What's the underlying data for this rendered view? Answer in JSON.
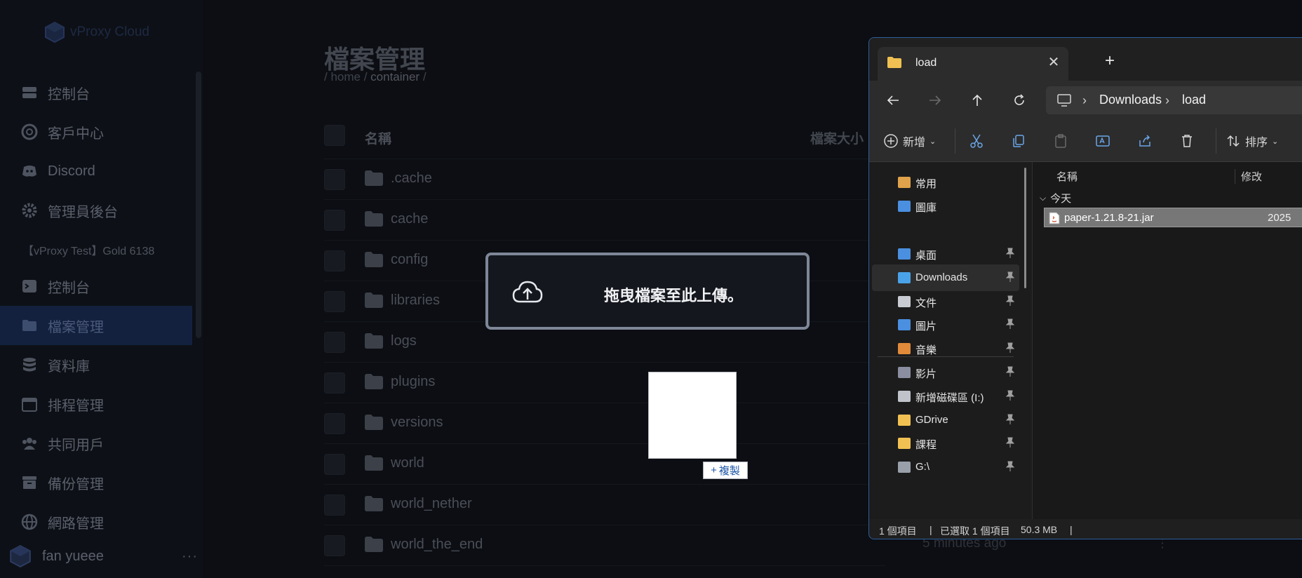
{
  "sidebar": {
    "logo": "vProxy Cloud",
    "items_top": [
      {
        "label": "控制台"
      },
      {
        "label": "客戶中心"
      },
      {
        "label": "Discord"
      },
      {
        "label": "管理員後台"
      }
    ],
    "server_section": "【vProxy Test】Gold 6138",
    "items_server": [
      {
        "label": "控制台"
      },
      {
        "label": "檔案管理"
      },
      {
        "label": "資料庫"
      },
      {
        "label": "排程管理"
      },
      {
        "label": "共同用戶"
      },
      {
        "label": "備份管理"
      },
      {
        "label": "網路管理"
      }
    ],
    "user": {
      "name": "fan yueee",
      "menu": "···"
    }
  },
  "main": {
    "title": "檔案管理",
    "breadcrumb": {
      "root": "/ home /",
      "current": "container",
      "tail": "/"
    },
    "columns": {
      "name": "名稱",
      "size": "檔案大小"
    },
    "rows": [
      {
        "name": ".cache"
      },
      {
        "name": "cache"
      },
      {
        "name": "config"
      },
      {
        "name": "libraries"
      },
      {
        "name": "logs"
      },
      {
        "name": "plugins"
      },
      {
        "name": "versions"
      },
      {
        "name": "world"
      },
      {
        "name": "world_nether"
      },
      {
        "name": "world_the_end"
      }
    ],
    "last_row_time": "5 minutes ago",
    "row_menu": "⋮"
  },
  "dropzone": {
    "text": "拖曳檔案至此上傳。",
    "icon": "cloud-upload-icon"
  },
  "drag": {
    "badge_label": "複製"
  },
  "explorer": {
    "tab_title": "load",
    "tab_close": "✕",
    "new_tab": "+",
    "address": {
      "crumb1": "Downloads",
      "crumb2": "load"
    },
    "toolbar": {
      "new": "新增",
      "sort": "排序"
    },
    "nav": [
      {
        "label": "常用"
      },
      {
        "label": "圖庫"
      },
      {
        "label": "桌面"
      },
      {
        "label": "Downloads"
      },
      {
        "label": "文件"
      },
      {
        "label": "圖片"
      },
      {
        "label": "音樂"
      },
      {
        "label": "影片"
      },
      {
        "label": "新增磁碟區 (I:)"
      },
      {
        "label": "GDrive"
      },
      {
        "label": "課程"
      },
      {
        "label": "G:\\"
      }
    ],
    "columns": {
      "name": "名稱",
      "modified": "修改"
    },
    "group": "今天",
    "file": {
      "name": "paper-1.21.8-21.jar",
      "date": "2025"
    },
    "status": {
      "count": "1 個項目",
      "selected": "已選取 1 個項目",
      "size": "50.3 MB"
    }
  }
}
